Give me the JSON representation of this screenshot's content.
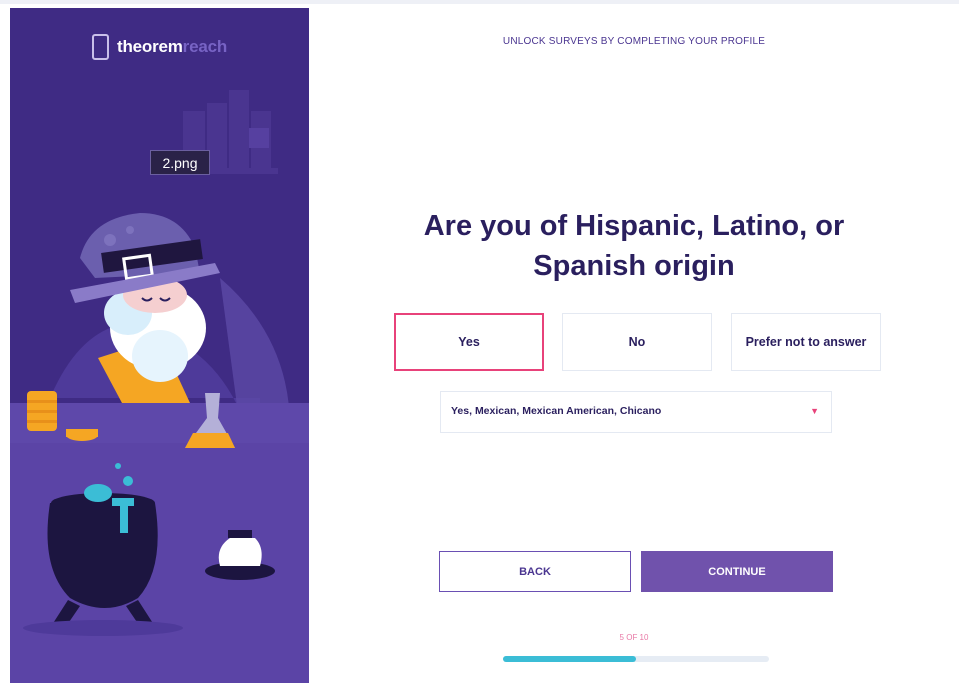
{
  "brand": {
    "name_bold": "theorem",
    "name_light": "reach"
  },
  "overlay_tag": "2.png",
  "header": {
    "title": "UNLOCK SURVEYS BY COMPLETING YOUR PROFILE"
  },
  "question": {
    "line1": "Are you of Hispanic, Latino, or",
    "line2": "Spanish origin"
  },
  "options": [
    {
      "label": "Yes",
      "selected": true
    },
    {
      "label": "No",
      "selected": false
    },
    {
      "label": "Prefer not to answer",
      "selected": false
    }
  ],
  "dropdown": {
    "value": "Yes, Mexican, Mexican American, Chicano",
    "caret_icon": "caret-down-icon"
  },
  "buttons": {
    "back": "BACK",
    "continue": "CONTINUE"
  },
  "progress": {
    "label": "5 OF 10",
    "fraction": 0.5
  },
  "colors": {
    "brand_purple": "#3f2b84",
    "accent_pink": "#e8427a",
    "progress_teal": "#3bbdd6",
    "button_purple": "#7052ac"
  }
}
